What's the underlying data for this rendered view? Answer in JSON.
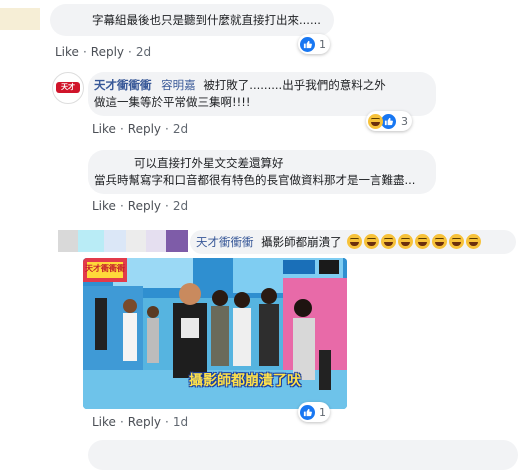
{
  "comments": [
    {
      "text_lines": [
        "字幕組最後也只是聽到什麼就直接打出來......"
      ],
      "like_label": "Like",
      "reply_label": "Reply",
      "time": "2d",
      "reaction_count": "1"
    },
    {
      "author": "天才衝衝衝",
      "mention": "容明嘉",
      "text_lines": [
        "被打敗了.........出乎我們的意料之外",
        "做這一集等於平常做三集啊!!!!"
      ],
      "like_label": "Like",
      "reply_label": "Reply",
      "time": "2d",
      "reaction_count": "3",
      "avatar_text": "天才"
    },
    {
      "text_lines": [
        "可以直接打外星文交差還算好",
        "當兵時幫寫字和口音都很有特色的長官做資料那才是一言難盡..."
      ],
      "like_label": "Like",
      "reply_label": "Reply",
      "time": "2d"
    },
    {
      "author": "天才衝衝衝",
      "text": "攝影師都崩潰了",
      "emoji_count": 8,
      "like_label": "Like",
      "reply_label": "Reply",
      "time": "1d",
      "reaction_count": "1",
      "photo_caption": "攝影師都崩潰了吠",
      "photo_sign": "天才衝衝衝"
    }
  ],
  "colors": {
    "link": "#385898",
    "bubble": "#f2f3f5",
    "like_blue": "#1877f2",
    "meta_gray": "#606770"
  }
}
